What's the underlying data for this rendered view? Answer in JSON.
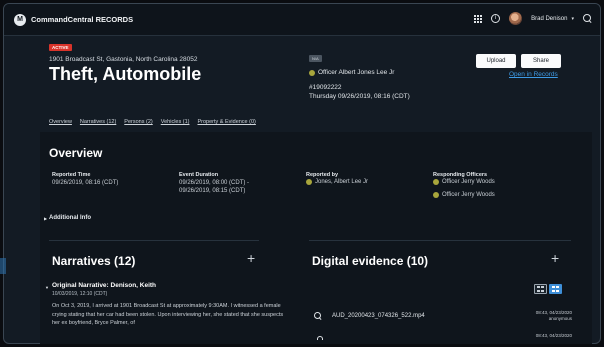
{
  "topbar": {
    "logo_letter": "M",
    "app_title": "CommandCentral RECORDS",
    "user_name": "Brad Denison",
    "caret": "▾"
  },
  "incident": {
    "status_badge": "ACTIVE",
    "address": "1901 Broadcast St, Gastonia, North Carolina 28052",
    "title": "Theft, Automobile",
    "small_badge": "N/A",
    "reporting_officer": "Officer Albert Jones Lee Jr",
    "case_number": "#19092222",
    "case_datetime": "Thursday 09/26/2019, 08:16 (CDT)",
    "upload_label": "Upload",
    "share_label": "Share",
    "open_link": "Open in Records"
  },
  "tabs": [
    "Overview",
    "Narratives (12)",
    "Persons (2)",
    "Vehicles (1)",
    "Property & Evidence (0)"
  ],
  "overview": {
    "title": "Overview",
    "reported_time_label": "Reported Time",
    "reported_time": "09/26/2019, 08:16 (CDT)",
    "event_duration_label": "Event Duration",
    "event_duration_1": "09/26/2019, 08:00 (CDT) -",
    "event_duration_2": "09/26/2019, 08:15 (CDT)",
    "reported_by_label": "Reported by",
    "reported_by": "Jones, Albert Lee Jr",
    "responding_label": "Responding Officers",
    "responding": [
      "Officer Jerry Woods",
      "Officer Jerry Woods"
    ],
    "additional_info": "Additional Info"
  },
  "narratives": {
    "title": "Narratives (12)",
    "add": "+",
    "item_title": "Original Narrative: Denison, Keith",
    "item_date": "10/03/2019, 12:10 (CDT)",
    "item_body": "On Oct 3, 2019, I arrived at 1901 Broadcast St at approximately 9:30AM. I witnessed a female crying stating that her car had been stolen. Upon interviewing her, she stated that she suspects her ex boyfriend, Bryce Palmer, of"
  },
  "evidence": {
    "title": "Digital evidence (10)",
    "add": "+",
    "file_name": "AUD_20200423_074326_522.mp4",
    "file_time": "08:43, 04/23/2020",
    "file_owner": "anonymous",
    "file2_time": "08:43, 04/23/2020"
  },
  "colors": {
    "accent_link": "#3e9be6",
    "active_badge": "#d9342b",
    "officer_dot": "#a8a63c"
  }
}
